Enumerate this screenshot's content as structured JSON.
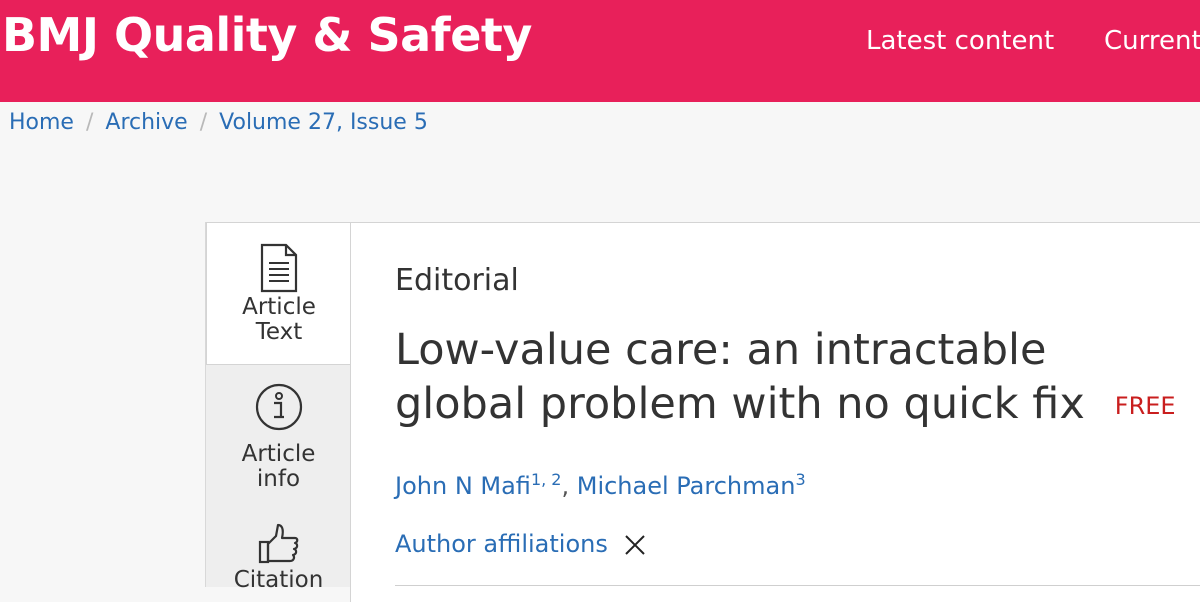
{
  "header": {
    "brand": "BMJ Quality & Safety",
    "nav": [
      {
        "label": "Latest content"
      },
      {
        "label": "Current"
      }
    ]
  },
  "breadcrumb": {
    "items": [
      {
        "label": "Home"
      },
      {
        "label": "Archive"
      },
      {
        "label": "Volume 27, Issue 5"
      }
    ],
    "separator": "/"
  },
  "sidebar": {
    "tabs": [
      {
        "label_line1": "Article",
        "label_line2": "Text",
        "icon": "document-icon",
        "active": true
      },
      {
        "label_line1": "Article",
        "label_line2": "info",
        "icon": "info-icon",
        "active": false
      },
      {
        "label_line1": "Citation",
        "label_line2": "",
        "icon": "thumbs-up-icon",
        "active": false
      }
    ]
  },
  "article": {
    "type": "Editorial",
    "title": "Low-value care: an intractable global problem with no quick fix",
    "access_badge": "FREE",
    "authors": [
      {
        "name": "John N Mafi",
        "affiliations": "1, 2"
      },
      {
        "name": "Michael Parchman",
        "affiliations": "3"
      }
    ],
    "author_separator": ", ",
    "affiliations_toggle": "Author affiliations"
  },
  "colors": {
    "brand": "#e8205a",
    "link": "#2a6db5",
    "free_badge": "#c91e1e"
  }
}
